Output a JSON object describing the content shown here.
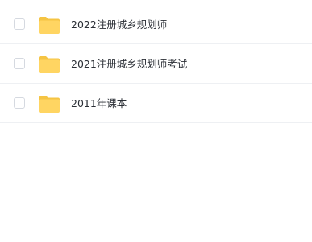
{
  "files": [
    {
      "name": "2022注册城乡规划师",
      "icon": "folder-icon",
      "checked": false
    },
    {
      "name": "2021注册城乡规划师考试",
      "icon": "folder-icon",
      "checked": false
    },
    {
      "name": "2011年课本",
      "icon": "folder-icon",
      "checked": false
    }
  ],
  "colors": {
    "folder_body": "#FFD562",
    "folder_tab": "#F5C443",
    "text": "#2B2F36",
    "divider": "#EEF0F3",
    "checkbox_border": "#D5D9E0"
  }
}
